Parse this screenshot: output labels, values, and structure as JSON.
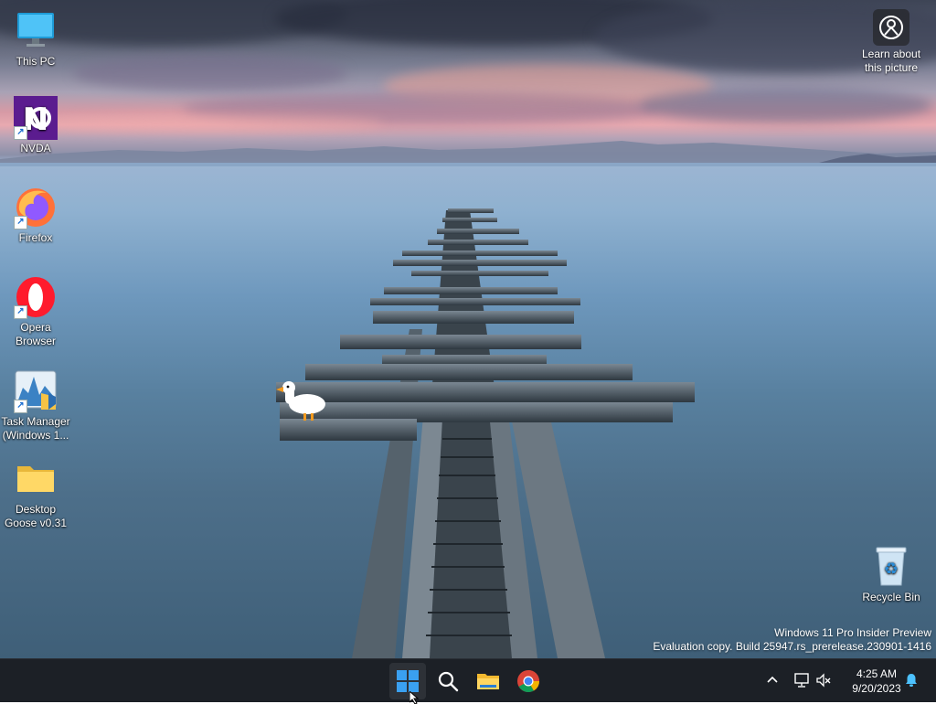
{
  "desktop": {
    "icons": [
      {
        "label": "This PC",
        "icon": "monitor-icon"
      },
      {
        "label": "NVDA",
        "icon": "nvda-icon"
      },
      {
        "label": "Firefox",
        "icon": "firefox-icon"
      },
      {
        "label": "Opera Browser",
        "icon": "opera-icon"
      },
      {
        "label": "Task Manager (Windows 1...",
        "icon": "task-manager-icon"
      },
      {
        "label": "Desktop Goose v0.31",
        "icon": "folder-icon"
      }
    ],
    "learn_about": {
      "label": "Learn about this picture",
      "icon": "camera-icon"
    },
    "recycle_bin": {
      "label": "Recycle Bin",
      "icon": "recycle-bin-icon"
    }
  },
  "watermark": {
    "line1": "Windows 11 Pro Insider Preview",
    "line2": "Evaluation copy. Build 25947.rs_prerelease.230901-1416"
  },
  "taskbar": {
    "apps": [
      {
        "name": "Start",
        "icon": "windows-start-icon"
      },
      {
        "name": "Search",
        "icon": "search-icon"
      },
      {
        "name": "File Explorer",
        "icon": "file-explorer-icon"
      },
      {
        "name": "Google Chrome",
        "icon": "chrome-icon"
      }
    ],
    "tray": {
      "time": "4:25 AM",
      "date": "9/20/2023",
      "icons": [
        "chevron-up-icon",
        "network-icon",
        "volume-muted-icon",
        "notification-bell-icon"
      ]
    }
  },
  "colors": {
    "taskbar_bg": "#1c2026",
    "start_blue": "#3aa0f0",
    "accent_notification": "#4cc2ff"
  }
}
